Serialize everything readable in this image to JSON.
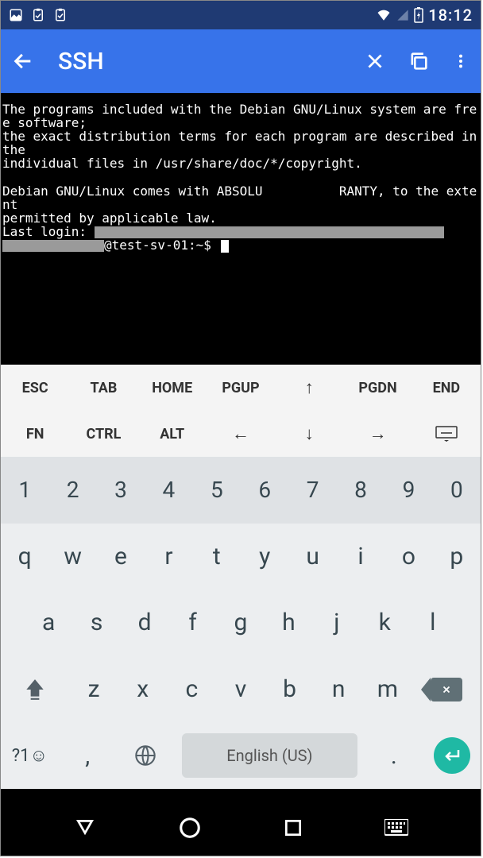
{
  "status": {
    "clock": "18:12"
  },
  "appbar": {
    "title": "SSH"
  },
  "terminal": {
    "line1": "The programs included with the Debian GNU/Linux system are free software;",
    "line2": "the exact distribution terms for each program are described in the",
    "line3": "individual files in /usr/share/doc/*/copyright.",
    "line4": "Debian GNU/Linux comes with ABSOLU          RANTY, to the extent",
    "line5": "permitted by applicable law.",
    "login_label": "Last login: ",
    "prompt_tail": "@test-sv-01:~$"
  },
  "termkeys": {
    "r1": [
      "ESC",
      "TAB",
      "HOME",
      "PGUP",
      "↑",
      "PGDN",
      "END"
    ],
    "r2": [
      "FN",
      "CTRL",
      "ALT",
      "←",
      "↓",
      "→",
      "⌨"
    ]
  },
  "kb": {
    "nums": [
      "1",
      "2",
      "3",
      "4",
      "5",
      "6",
      "7",
      "8",
      "9",
      "0"
    ],
    "row1": [
      "q",
      "w",
      "e",
      "r",
      "t",
      "y",
      "u",
      "i",
      "o",
      "p"
    ],
    "row2": [
      "a",
      "s",
      "d",
      "f",
      "g",
      "h",
      "j",
      "k",
      "l"
    ],
    "row3": [
      "z",
      "x",
      "c",
      "v",
      "b",
      "n",
      "m"
    ],
    "sym": "?1☺",
    "comma": ",",
    "space": "English (US)",
    "dot": "."
  }
}
